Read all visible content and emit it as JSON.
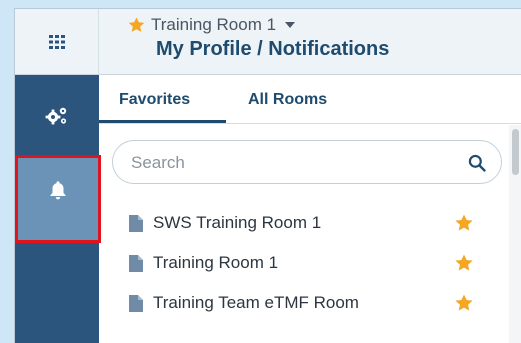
{
  "header": {
    "room_name": "Training Room 1",
    "page_title": "My Profile / Notifications",
    "star_color": "#f5a623",
    "apps_icon": "grid-icon",
    "dropdown_icon": "caret-down-icon"
  },
  "rail": {
    "items": [
      {
        "name": "settings",
        "icon": "gears-icon"
      },
      {
        "name": "notifications",
        "icon": "bell-icon",
        "selected": true,
        "highlight_color": "#e0141c"
      }
    ]
  },
  "tabs": [
    {
      "label": "Favorites",
      "active": true
    },
    {
      "label": "All Rooms",
      "active": false
    }
  ],
  "search": {
    "placeholder": "Search",
    "value": "",
    "icon": "search-icon"
  },
  "rooms": [
    {
      "label": "SWS Training Room 1",
      "favorite": true
    },
    {
      "label": "Training Room 1",
      "favorite": true
    },
    {
      "label": "Training Team eTMF Room",
      "favorite": true
    }
  ]
}
